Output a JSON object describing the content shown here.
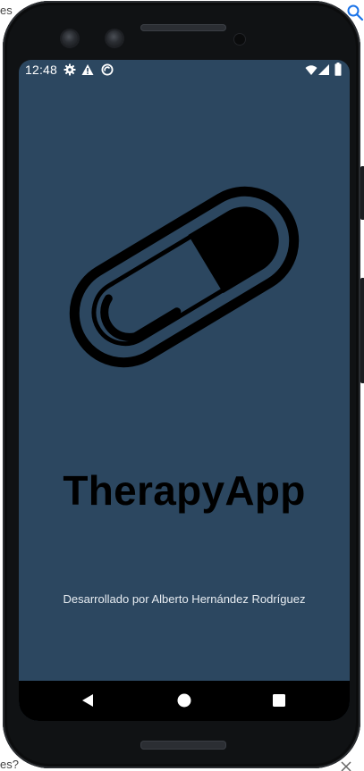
{
  "background_page": {
    "fragment_top_left": "es",
    "fragment_bottom_left": "es?",
    "icons": [
      "search-icon",
      "close-icon"
    ]
  },
  "status_bar": {
    "time": "12:48",
    "left_icons": [
      "gear-icon",
      "warning-icon",
      "sync-icon"
    ],
    "right_icons": [
      "wifi-icon",
      "signal-icon",
      "battery-icon"
    ]
  },
  "splash": {
    "logo_icon": "pill-capsule-icon",
    "app_name": "TherapyApp",
    "credits": "Desarrollado por Alberto Hernández Rodríguez",
    "background_color": "#2c4760",
    "title_color": "#000000"
  },
  "navigation_bar": {
    "buttons": [
      "back-icon",
      "home-icon",
      "recent-apps-icon"
    ]
  }
}
